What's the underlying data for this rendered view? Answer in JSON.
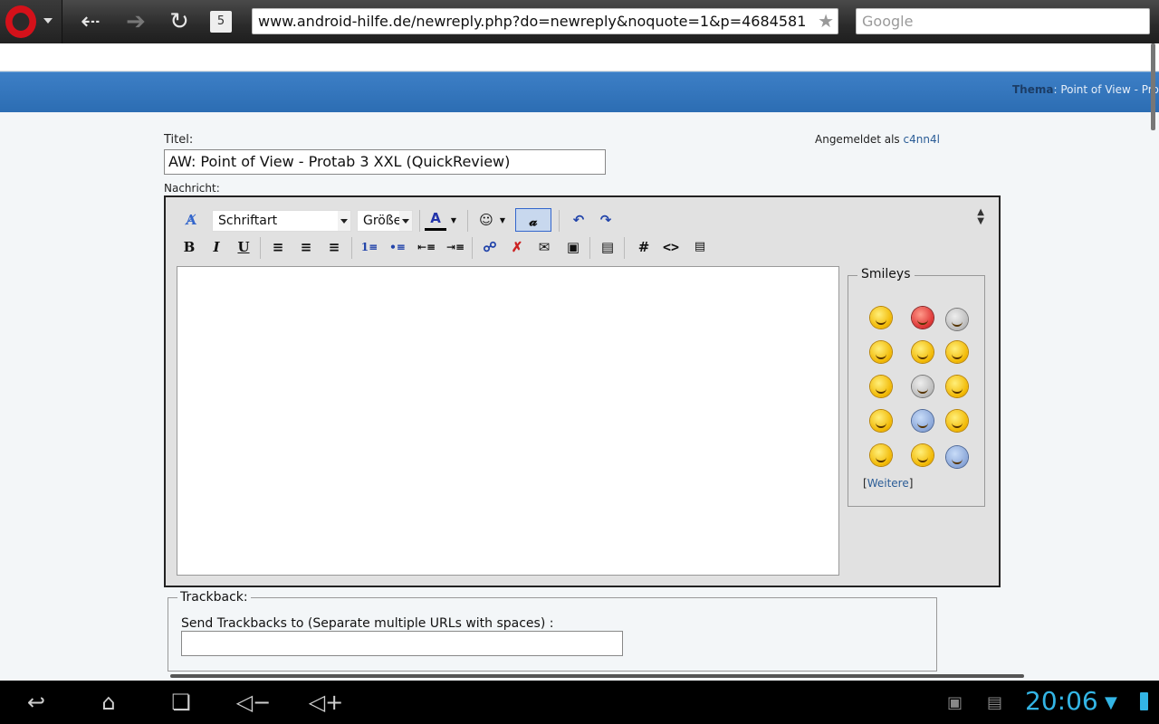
{
  "browser": {
    "url": "www.android-hilfe.de/newreply.php?do=newreply&noquote=1&p=4684581",
    "search_placeholder": "Google",
    "tab_count": "5"
  },
  "header": {
    "thema_label": "Thema",
    "thema_value": ": Point of View - Pro"
  },
  "form": {
    "title_label": "Titel:",
    "title_value": "AW: Point of View - Protab 3 XXL (QuickReview)",
    "message_label": "Nachricht:",
    "logged_in_prefix": "Angemeldet als",
    "username": "c4nn4l"
  },
  "editor": {
    "font_select": "Schriftart",
    "size_select": "Größe",
    "smileys_legend": "Smileys",
    "more_smileys": "Weitere"
  },
  "trackback": {
    "legend": "Trackback:",
    "description": "Send Trackbacks to (Separate multiple URLs with spaces) :"
  },
  "statusbar": {
    "time": "20:06"
  }
}
